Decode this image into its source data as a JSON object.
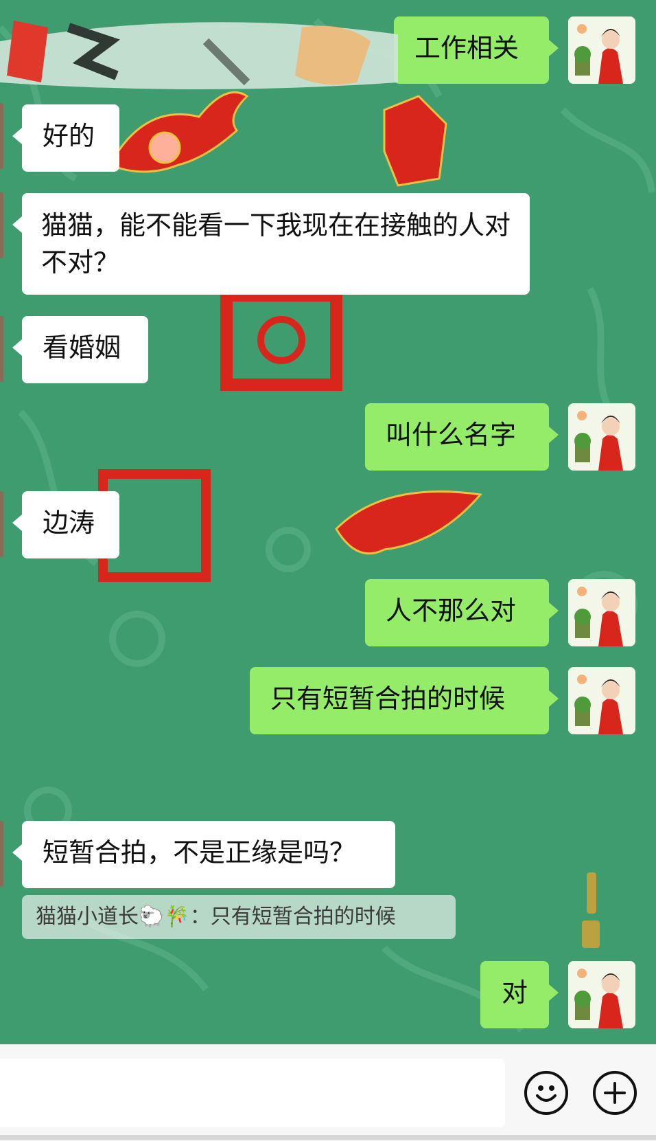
{
  "chat": {
    "messages": [
      {
        "side": "right",
        "text": "工作相关"
      },
      {
        "side": "left",
        "text": "好的"
      },
      {
        "side": "left",
        "text": "猫猫，能不能看一下我现在在接触的人对不对？"
      },
      {
        "side": "left",
        "text": "看婚姻"
      },
      {
        "side": "right",
        "text": "叫什么名字"
      },
      {
        "side": "left",
        "text": "边涛"
      },
      {
        "side": "right",
        "text": "人不那么对"
      },
      {
        "side": "right",
        "text": "只有短暂合拍的时候"
      },
      {
        "side": "left",
        "text": "短暂合拍，不是正缘是吗？"
      },
      {
        "side": "right",
        "text": "对"
      }
    ],
    "quote": {
      "sender": "猫猫小道长🐑🎋",
      "separator": "：",
      "text": "只有短暂合拍的时候"
    },
    "redacted_message": "scribbled-out"
  },
  "input_bar": {
    "input_value": "",
    "emoji_icon": "emoji-face-icon",
    "add_icon": "plus-circle-icon"
  },
  "colors": {
    "background": "#3e9c6e",
    "bubble_right": "#95ec69",
    "bubble_left": "#ffffff",
    "seal_red": "#d9261c"
  }
}
